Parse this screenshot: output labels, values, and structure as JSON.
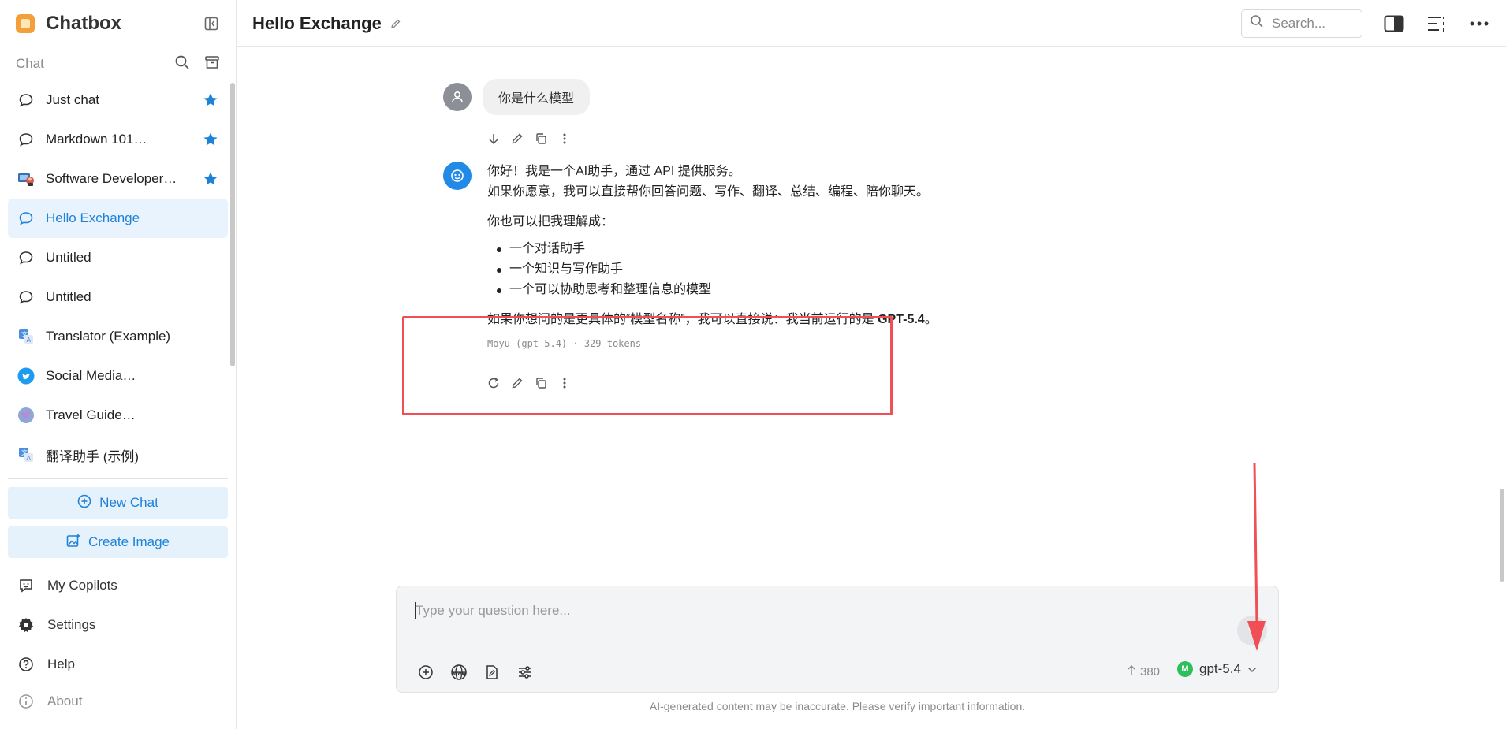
{
  "app": {
    "name": "Chatbox"
  },
  "sidebar": {
    "section_label": "Chat",
    "chats": [
      {
        "label": "Just chat",
        "icon": "chat-bubble-icon",
        "starred": true,
        "active": false
      },
      {
        "label": "Markdown 101…",
        "icon": "chat-bubble-icon",
        "starred": true,
        "active": false
      },
      {
        "label": "Software Developer…",
        "icon": "developer-avatar-icon",
        "starred": true,
        "active": false
      },
      {
        "label": "Hello Exchange",
        "icon": "chat-bubble-icon",
        "starred": false,
        "active": true
      },
      {
        "label": "Untitled",
        "icon": "chat-bubble-icon",
        "starred": false,
        "active": false
      },
      {
        "label": "Untitled",
        "icon": "chat-bubble-icon",
        "starred": false,
        "active": false
      },
      {
        "label": "Translator (Example)",
        "icon": "translate-icon",
        "starred": false,
        "active": false
      },
      {
        "label": "Social Media…",
        "icon": "twitter-icon",
        "starred": false,
        "active": false
      },
      {
        "label": "Travel Guide…",
        "icon": "globe-avatar-icon",
        "starred": false,
        "active": false
      },
      {
        "label": "翻译助手 (示例)",
        "icon": "translate-icon",
        "starred": false,
        "active": false
      }
    ],
    "new_chat_label": "New Chat",
    "create_image_label": "Create Image",
    "nav": {
      "copilots": "My Copilots",
      "settings": "Settings",
      "help": "Help",
      "about": "About"
    }
  },
  "header": {
    "title": "Hello Exchange",
    "search_placeholder": "Search..."
  },
  "conversation": {
    "user_message": "你是什么模型",
    "bot": {
      "line1": "你好！我是一个AI助手，通过 API 提供服务。",
      "line2": "如果你愿意，我可以直接帮你回答问题、写作、翻译、总结、编程、陪你聊天。",
      "line3": "你也可以把我理解成：",
      "bullets": [
        "一个对话助手",
        "一个知识与写作助手",
        "一个可以协助思考和整理信息的模型"
      ],
      "final_prefix": "如果你想问的是更具体的“模型名称”，我可以直接说：我当前运行的是 ",
      "final_bold": "GPT-5.4",
      "final_suffix": "。",
      "meta": "Moyu (gpt-5.4) · 329 tokens"
    }
  },
  "composer": {
    "placeholder": "Type your question here...",
    "token_count": "380",
    "model": "gpt-5.4",
    "model_badge": "M",
    "disclaimer": "AI-generated content may be inaccurate. Please verify important information."
  },
  "colors": {
    "accent": "#1e83d8",
    "highlight_border": "#ef4f55",
    "model_badge": "#2fbe5c"
  }
}
